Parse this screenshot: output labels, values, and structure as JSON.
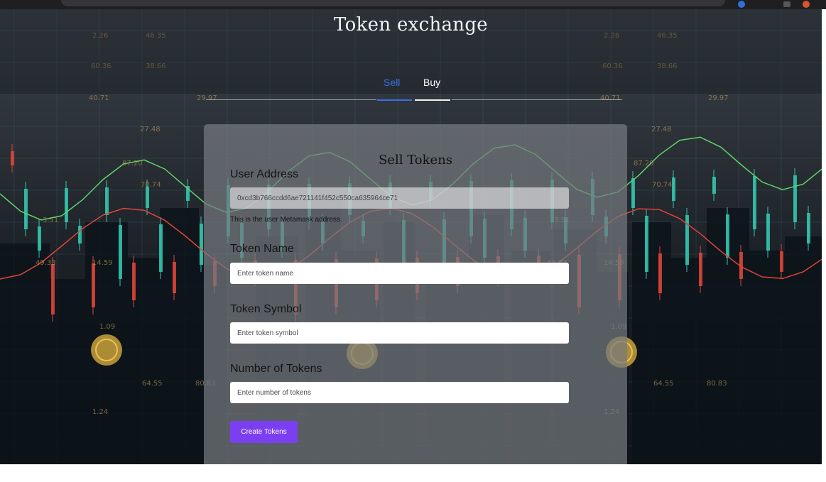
{
  "page": {
    "title": "Token exchange"
  },
  "tabs": {
    "sell_label": "Sell",
    "buy_label": "Buy",
    "active": "Sell"
  },
  "form": {
    "heading": "Sell Tokens",
    "user_address": {
      "label": "User Address",
      "value": "0xcd3b766ccdd6ae721141f452c550ca635964ce71",
      "help": "This is the user Metamask address."
    },
    "token_name": {
      "label": "Token Name",
      "placeholder": "Enter token name"
    },
    "token_symbol": {
      "label": "Token Symbol",
      "placeholder": "Enter token symbol"
    },
    "number_of_tokens": {
      "label": "Number of Tokens",
      "placeholder": "Enter number of tokens"
    },
    "submit_label": "Create Tokens"
  },
  "background": {
    "ticker_numbers": [
      "2.26",
      "46.35",
      "60.36",
      "38.66",
      "40.71",
      "29.97",
      "27.48",
      "87.20",
      "70.74",
      "49.33",
      "14.59",
      "64.55",
      "80.83",
      "1.24",
      "3.51",
      "1.09"
    ]
  },
  "browser": {
    "icons": [
      "extension-icon",
      "profile-icon",
      "menu-icon"
    ]
  },
  "colors": {
    "accent_blue": "#3d6ee6",
    "button_purple": "#7b3ff2",
    "card_overlay": "#767a80"
  }
}
